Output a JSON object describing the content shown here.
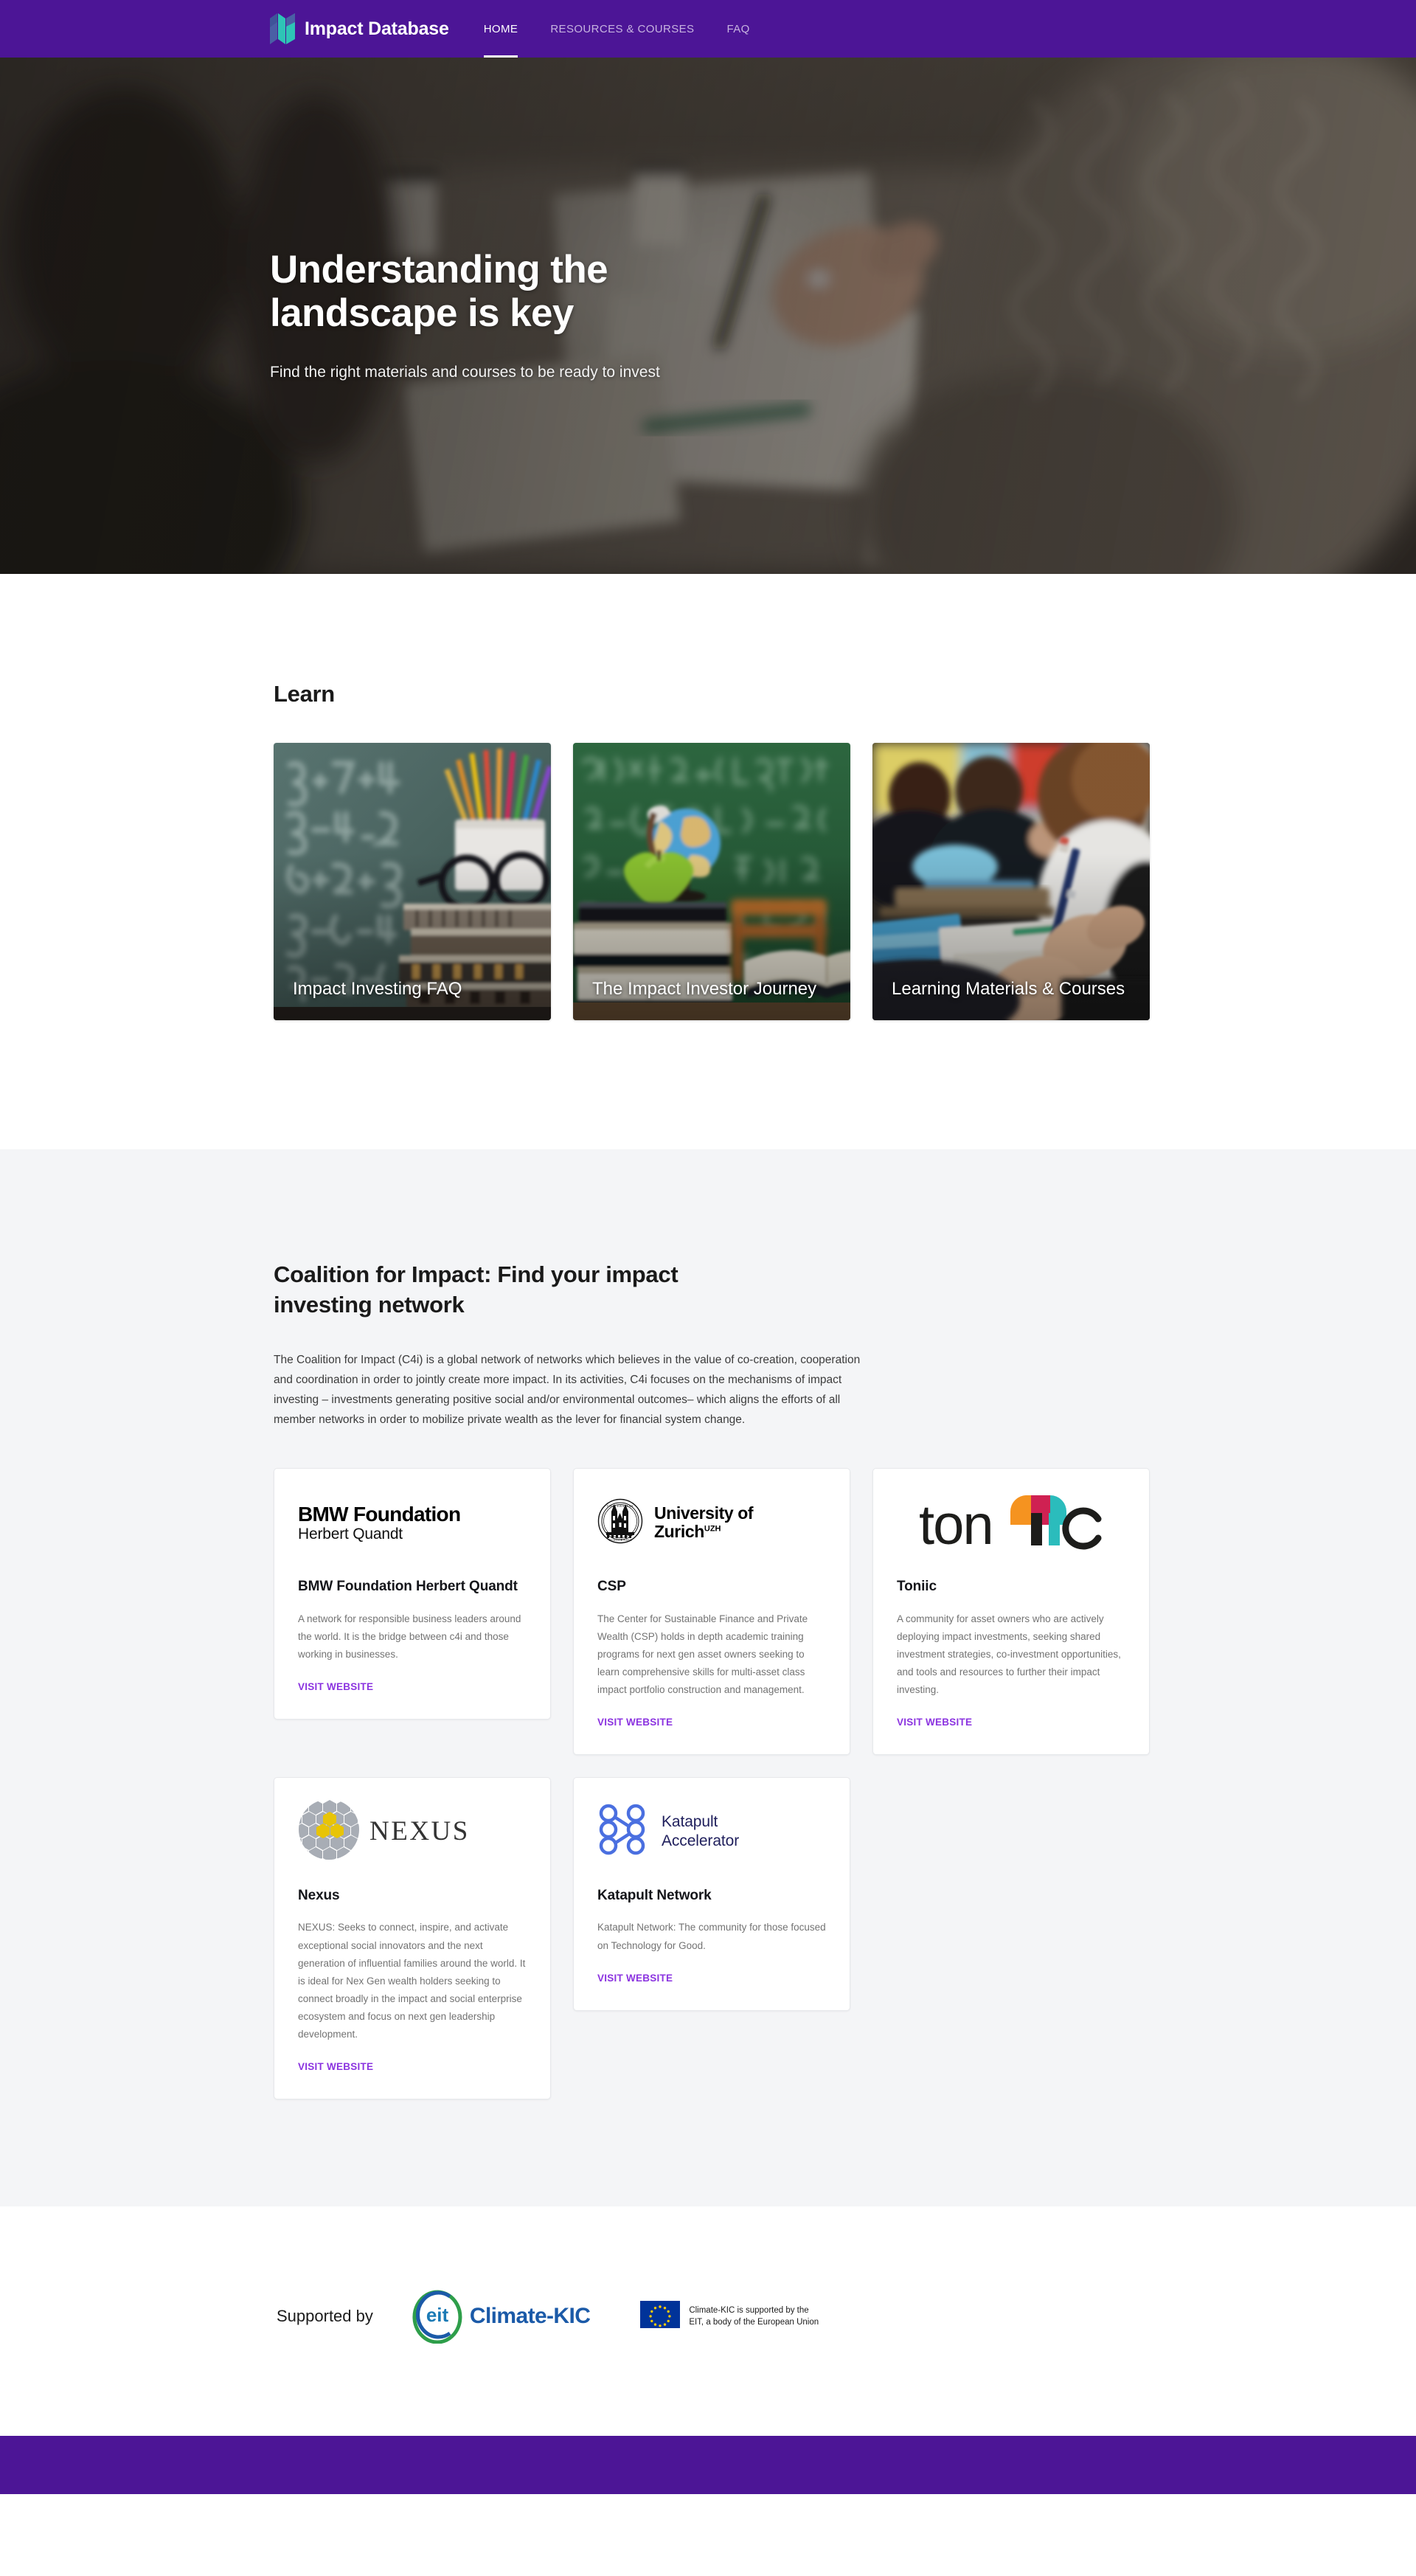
{
  "brand": {
    "name": "Impact Database",
    "logo_icon": "book-panels-icon",
    "colors": {
      "purple": "#4c1596",
      "teal": "#2ec4b6",
      "blue": "#4a5fa5"
    }
  },
  "nav": {
    "items": [
      {
        "label": "HOME",
        "active": true
      },
      {
        "label": "RESOURCES & COURSES",
        "active": false
      },
      {
        "label": "FAQ",
        "active": false
      }
    ]
  },
  "hero": {
    "title": "Understanding the landscape is key",
    "subtitle": "Find the right materials and courses to be ready to invest",
    "image_description": "People seated around a table with papers, a hand writing with a pen, coffee cups"
  },
  "learn": {
    "title": "Learn",
    "cards": [
      {
        "label": "Impact Investing FAQ",
        "image_description": "Chalkboard with arithmetic sums, cup of coloured pencils, glasses resting on a stack of old books"
      },
      {
        "label": "The Impact Investor Journey",
        "image_description": "Green chalkboard covered with equations, globe and green apple on a stack of books, open book on a desk"
      },
      {
        "label": "Learning Materials & Courses",
        "image_description": "Classroom of students at desks, a girl in a white shirt writing with a pencil"
      }
    ]
  },
  "coalition": {
    "title": "Coalition for Impact: Find your impact investing network",
    "body": "The Coalition for Impact (C4i) is a global network of networks which believes in the value of co-creation, cooperation and coordination in order to jointly create more impact. In its activities, C4i focuses on the mechanisms of impact investing – investments generating positive social and/or environmental outcomes– which aligns the efforts of all member networks in order to mobilize private wealth as the lever for financial system change.",
    "link_label": "VISIT WEBSITE",
    "link_color": "#8b33e0",
    "partners": [
      {
        "logo_icon": "bmw-foundation-logo",
        "logo_line1": "BMW Foundation",
        "logo_line2": "Herbert Quandt",
        "name": "BMW Foundation Herbert Quandt",
        "description": "A network for responsible business leaders around the world.  It is the bridge between c4i and those working in businesses."
      },
      {
        "logo_icon": "university-of-zurich-logo",
        "logo_line1": "University of",
        "logo_line2": "Zurich",
        "logo_superscript": "UZH",
        "name": "CSP",
        "description": "The Center for Sustainable Finance and Private Wealth (CSP) holds in depth academic training programs for next gen asset owners seeking to learn comprehensive skills for multi-asset class impact portfolio construction and management."
      },
      {
        "logo_icon": "toniic-logo",
        "logo_wordmark": "toniic",
        "name": "Toniic",
        "description": "A community for asset owners who are actively deploying impact investments, seeking shared investment strategies, co-investment opportunities, and tools and resources to further their impact investing."
      },
      {
        "logo_icon": "nexus-logo",
        "logo_wordmark": "NEXUS",
        "name": "Nexus",
        "description": "NEXUS: Seeks to connect, inspire, and activate exceptional social innovators and the next generation of influential families around the world.  It is ideal for Nex Gen wealth holders seeking to connect broadly in the impact and social enterprise ecosystem and focus on next gen leadership development."
      },
      {
        "logo_icon": "katapult-accelerator-logo",
        "logo_line1": "Katapult",
        "logo_line2": "Accelerator",
        "name": "Katapult Network",
        "description": "Katapult Network: The community for those focused on Technology for Good."
      }
    ]
  },
  "supported": {
    "label": "Supported by",
    "climate_kic": {
      "icon": "eit-climate-kic-logo",
      "mark": "eit",
      "word": "Climate-KIC"
    },
    "eu": {
      "icon": "european-union-flag",
      "line1": "Climate-KIC is supported by the",
      "line2": "EIT, a body of the European Union"
    }
  }
}
